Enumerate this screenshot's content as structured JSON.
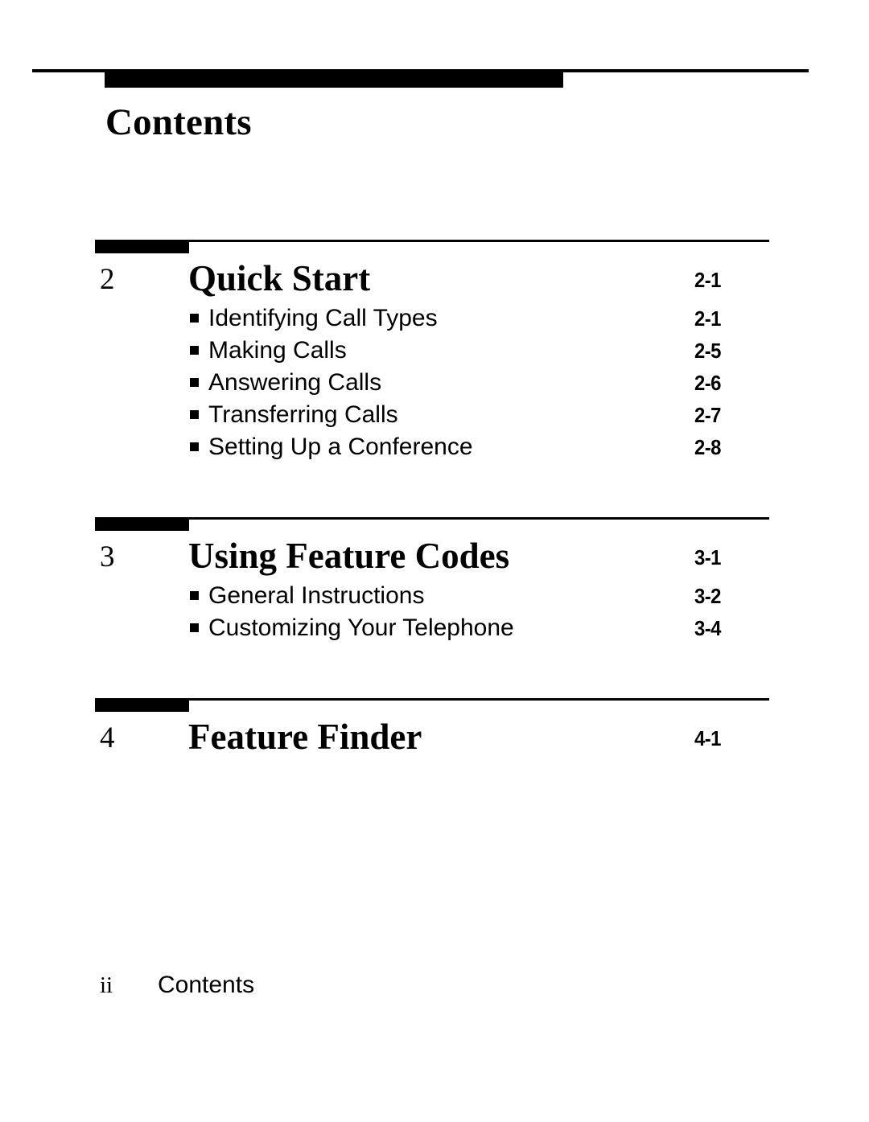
{
  "document": {
    "title": "Contents",
    "footer": {
      "folio": "ii",
      "label": "Contents"
    },
    "colors": {
      "ink": "#000000",
      "paper": "#ffffff"
    }
  },
  "chapters": [
    {
      "number": "2",
      "title": "Quick Start",
      "page": "2-1",
      "entries": [
        {
          "label": "Identifying Call Types",
          "page": "2-1"
        },
        {
          "label": "Making Calls",
          "page": "2-5"
        },
        {
          "label": "Answering Calls",
          "page": "2-6"
        },
        {
          "label": "Transferring Calls",
          "page": "2-7"
        },
        {
          "label": "Setting Up a Conference",
          "page": "2-8"
        }
      ]
    },
    {
      "number": "3",
      "title": "Using Feature Codes",
      "page": "3-1",
      "entries": [
        {
          "label": "General Instructions",
          "page": "3-2"
        },
        {
          "label": "Customizing Your Telephone",
          "page": "3-4"
        }
      ]
    },
    {
      "number": "4",
      "title": "Feature Finder",
      "page": "4-1",
      "entries": []
    }
  ]
}
